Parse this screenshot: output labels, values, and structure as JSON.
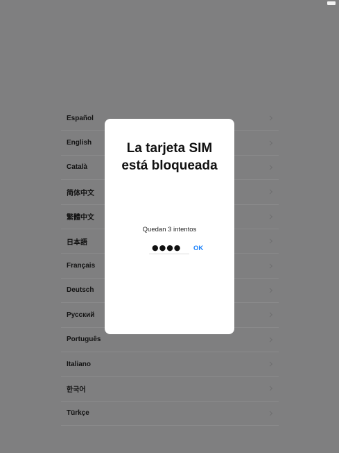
{
  "status_bar": {
    "battery_icon": "battery-icon"
  },
  "language_list": {
    "items": [
      {
        "label": "Español"
      },
      {
        "label": "English"
      },
      {
        "label": "Català"
      },
      {
        "label": "简体中文"
      },
      {
        "label": "繁體中文"
      },
      {
        "label": "日本語"
      },
      {
        "label": "Français"
      },
      {
        "label": "Deutsch"
      },
      {
        "label": "Русский"
      },
      {
        "label": "Português"
      },
      {
        "label": "Italiano"
      },
      {
        "label": "한국어"
      },
      {
        "label": "Türkçe"
      }
    ],
    "chevron_icon": "chevron-right-icon"
  },
  "sim_dialog": {
    "title": "La tarjeta SIM\nestá bloqueada",
    "attempts_text": "Quedan 3 intentos",
    "pin_value": "●●●●",
    "ok_label": "OK",
    "accent_color": "#157efb"
  },
  "colors": {
    "background": "#7f7f80",
    "dialog": "#ffffff"
  }
}
